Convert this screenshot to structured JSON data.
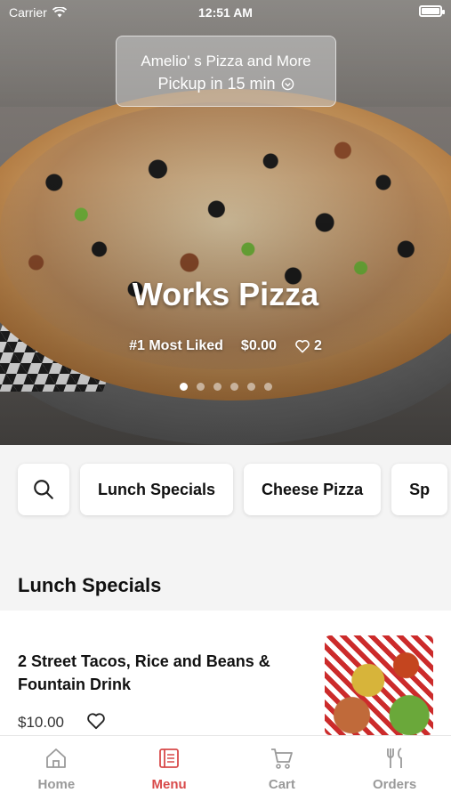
{
  "status_bar": {
    "carrier": "Carrier",
    "time": "12:51 AM",
    "battery_level": 1.0
  },
  "location": {
    "name": "Amelio' s Pizza and More",
    "pickup": "Pickup in 15 min"
  },
  "featured": {
    "title": "Works Pizza",
    "rank": "#1 Most Liked",
    "price": "$0.00",
    "likes": "2",
    "slide_count": 6,
    "active_slide": 1
  },
  "categories": [
    {
      "label": "Lunch Specials"
    },
    {
      "label": "Cheese Pizza"
    },
    {
      "label": "Sp"
    }
  ],
  "section": {
    "title": "Lunch Specials"
  },
  "items": [
    {
      "name": "2 Street Tacos, Rice and Beans & Fountain Drink",
      "price": "$10.00"
    }
  ],
  "tabs": [
    {
      "label": "Home",
      "icon": "home-icon",
      "active": false
    },
    {
      "label": "Menu",
      "icon": "menu-icon",
      "active": true
    },
    {
      "label": "Cart",
      "icon": "cart-icon",
      "active": false
    },
    {
      "label": "Orders",
      "icon": "orders-icon",
      "active": false
    }
  ],
  "colors": {
    "accent": "#d84a4a",
    "inactive_tab": "#9a9a9a"
  }
}
